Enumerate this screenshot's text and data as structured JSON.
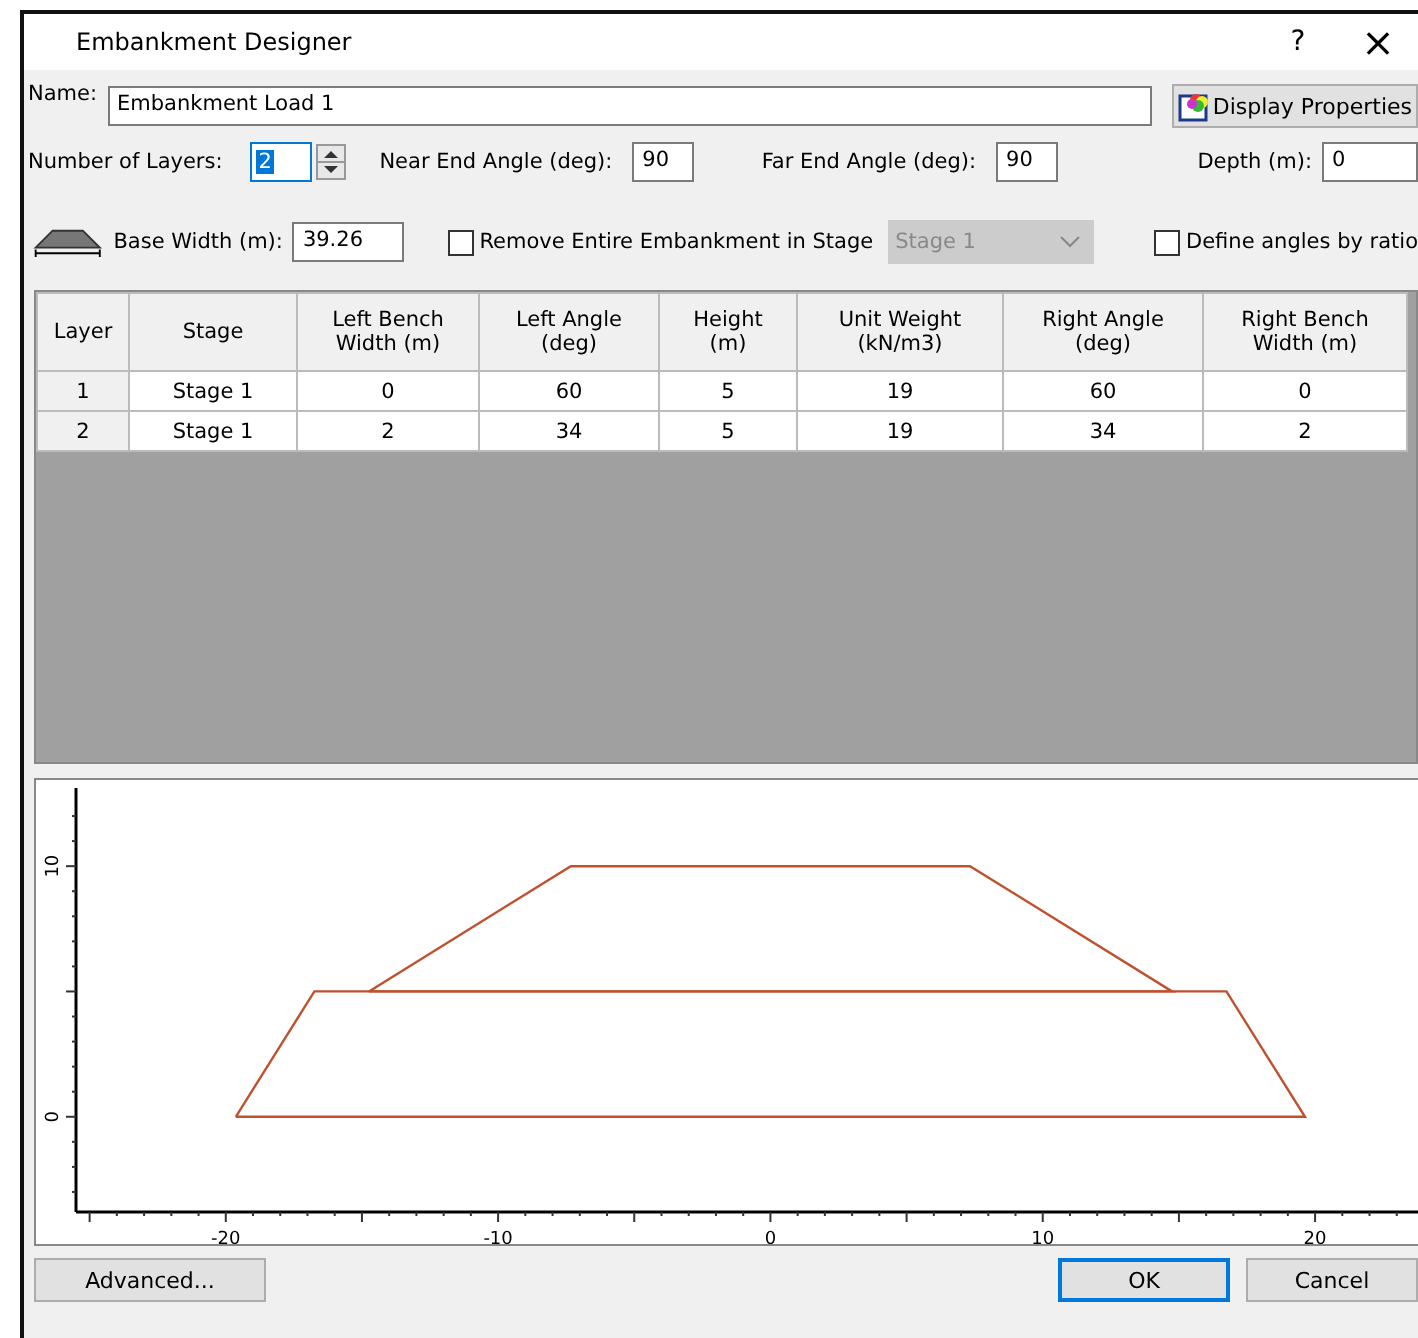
{
  "window": {
    "title": "Embankment Designer",
    "help": "?",
    "close": "×"
  },
  "name": {
    "label": "Name:",
    "value": "Embankment Load 1"
  },
  "display_properties": {
    "label": "Display Properties"
  },
  "number_of_layers": {
    "label": "Number of Layers:",
    "value": "2"
  },
  "near_end_angle": {
    "label": "Near End Angle (deg):",
    "value": "90"
  },
  "far_end_angle": {
    "label": "Far End Angle (deg):",
    "value": "90"
  },
  "depth": {
    "label": "Depth (m):",
    "value": "0"
  },
  "base_width": {
    "label": "Base Width (m):",
    "value": "39.26"
  },
  "remove_embankment": {
    "label": "Remove Entire Embankment in Stage",
    "checked": false
  },
  "stage_select": {
    "value": "Stage 1",
    "disabled": true
  },
  "define_angles_by_ratio": {
    "label": "Define angles by ratio",
    "checked": false
  },
  "table": {
    "columns": [
      "Layer",
      "Stage",
      "Left Bench\nWidth (m)",
      "Left Angle\n(deg)",
      "Height\n(m)",
      "Unit Weight\n(kN/m3)",
      "Right Angle\n(deg)",
      "Right Bench\nWidth (m)"
    ],
    "rows": [
      [
        "1",
        "Stage 1",
        "0",
        "60",
        "5",
        "19",
        "60",
        "0"
      ],
      [
        "2",
        "Stage 1",
        "2",
        "34",
        "5",
        "19",
        "34",
        "2"
      ]
    ]
  },
  "preview": {
    "x_tick_labels": [
      "-20",
      "-10",
      "0",
      "10",
      "20"
    ],
    "y_tick_labels": [
      "0",
      "10"
    ]
  },
  "buttons": [
    {
      "label": "Advanced...",
      "default": false
    },
    {
      "label": "OK",
      "default": true
    },
    {
      "label": "Cancel",
      "default": false
    }
  ]
}
